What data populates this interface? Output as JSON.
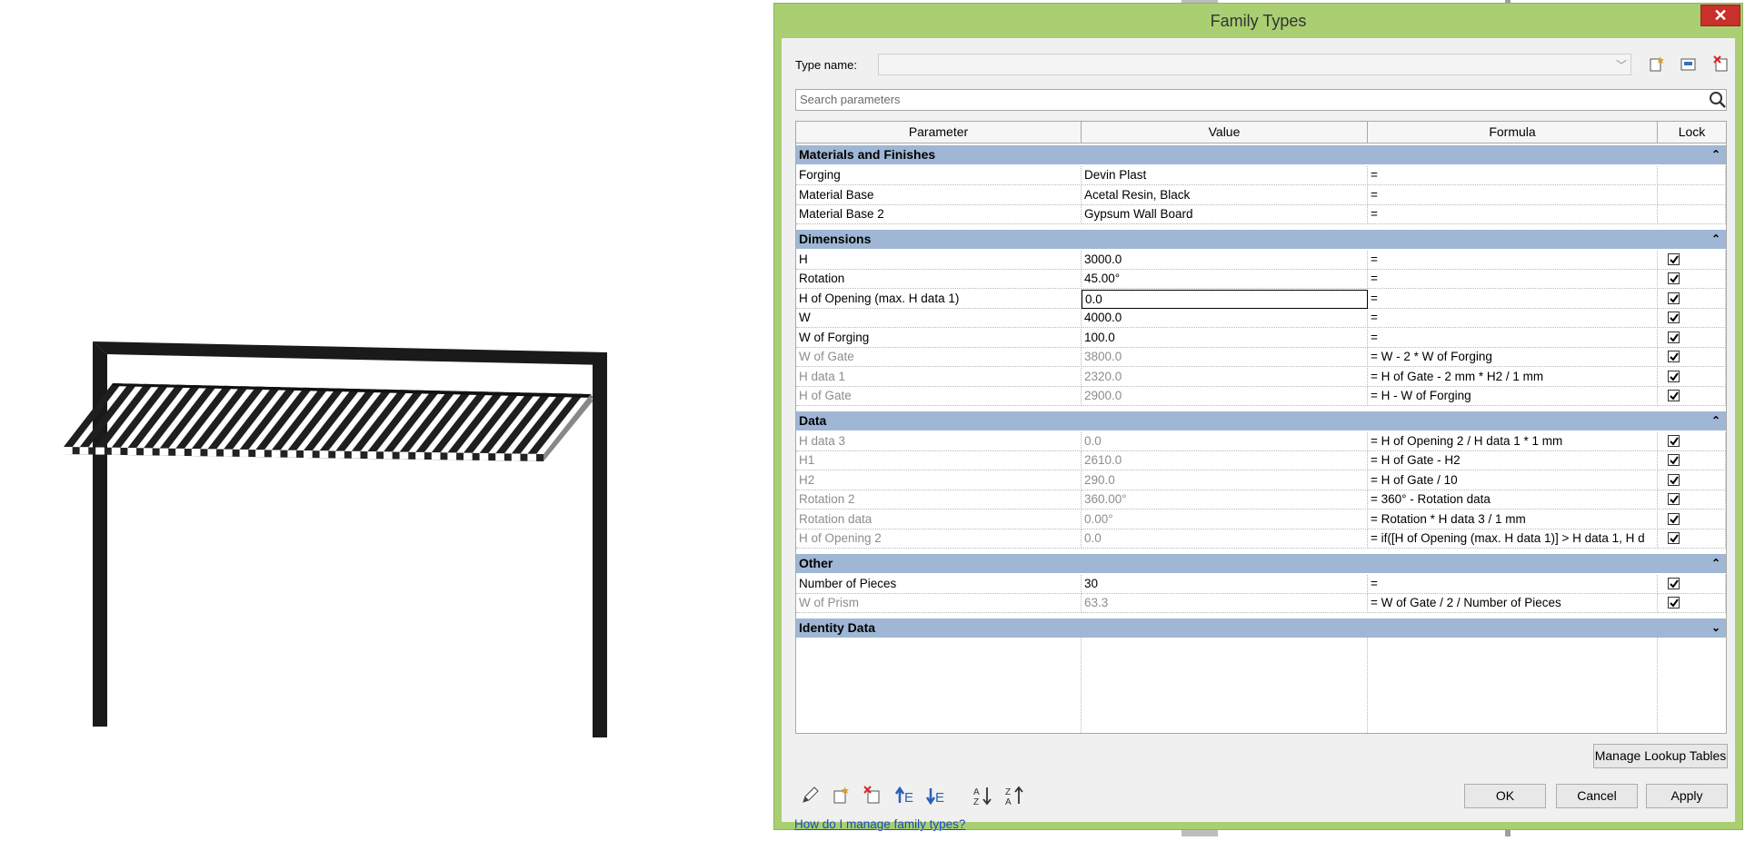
{
  "dialog": {
    "title": "Family Types",
    "close_label": "✕",
    "type_name_label": "Type name:",
    "type_name_value": "",
    "search_placeholder": "Search parameters"
  },
  "columns": [
    "Parameter",
    "Value",
    "Formula",
    "Lock"
  ],
  "groups": [
    {
      "name": "Materials and Finishes",
      "rows": [
        {
          "param": "Forging",
          "value": "Devin Plast",
          "formula": "=",
          "lock": null,
          "grey": false
        },
        {
          "param": "Material Base",
          "value": "Acetal Resin, Black",
          "formula": "=",
          "lock": null,
          "grey": false
        },
        {
          "param": "Material Base 2",
          "value": "Gypsum Wall Board",
          "formula": "=",
          "lock": null,
          "grey": false
        }
      ]
    },
    {
      "name": "Dimensions",
      "rows": [
        {
          "param": "H",
          "value": "3000.0",
          "formula": "=",
          "lock": true,
          "grey": false
        },
        {
          "param": "Rotation",
          "value": "45.00°",
          "formula": "=",
          "lock": true,
          "grey": false
        },
        {
          "param": "H of Opening (max. H data 1)",
          "value": "0.0",
          "formula": "=",
          "lock": true,
          "grey": false,
          "editing": true
        },
        {
          "param": "W",
          "value": "4000.0",
          "formula": "=",
          "lock": true,
          "grey": false
        },
        {
          "param": "W of Forging",
          "value": "100.0",
          "formula": "=",
          "lock": true,
          "grey": false
        },
        {
          "param": "W of Gate",
          "value": "3800.0",
          "formula": "= W - 2 * W of Forging",
          "lock": true,
          "grey": true
        },
        {
          "param": "H data 1",
          "value": "2320.0",
          "formula": "= H of Gate - 2 mm * H2 / 1 mm",
          "lock": true,
          "grey": true
        },
        {
          "param": "H of Gate",
          "value": "2900.0",
          "formula": "= H - W of Forging",
          "lock": true,
          "grey": true
        }
      ]
    },
    {
      "name": "Data",
      "rows": [
        {
          "param": "H data 3",
          "value": "0.0",
          "formula": "= H of Opening 2 / H data 1 * 1 mm",
          "lock": true,
          "grey": true
        },
        {
          "param": "H1",
          "value": "2610.0",
          "formula": "= H of Gate - H2",
          "lock": true,
          "grey": true
        },
        {
          "param": "H2",
          "value": "290.0",
          "formula": "= H of Gate / 10",
          "lock": true,
          "grey": true
        },
        {
          "param": "Rotation 2",
          "value": "360.00°",
          "formula": "= 360° - Rotation data",
          "lock": true,
          "grey": true
        },
        {
          "param": "Rotation data",
          "value": "0.00°",
          "formula": "= Rotation * H data 3 / 1 mm",
          "lock": true,
          "grey": true
        },
        {
          "param": "H of Opening 2",
          "value": "0.0",
          "formula": "= if([H of Opening (max. H data 1)] > H data 1, H d",
          "lock": true,
          "grey": true
        }
      ]
    },
    {
      "name": "Other",
      "rows": [
        {
          "param": "Number of Pieces",
          "value": "30",
          "formula": "=",
          "lock": true,
          "grey": false
        },
        {
          "param": "W of Prism",
          "value": "63.3",
          "formula": "= W of Gate / 2 / Number of Pieces",
          "lock": true,
          "grey": true
        }
      ]
    },
    {
      "name": "Identity Data",
      "rows": []
    }
  ],
  "buttons": {
    "manage_lookup": "Manage Lookup Tables",
    "ok": "OK",
    "cancel": "Cancel",
    "apply": "Apply"
  },
  "help_link": "How do I manage family types?",
  "icons": {
    "toolbar": [
      "new-type-icon",
      "rename-type-icon",
      "delete-type-icon"
    ],
    "bottom": [
      "edit-parameter-icon",
      "new-parameter-icon",
      "delete-parameter-icon",
      "move-up-icon",
      "move-down-icon",
      "sort-ascending-icon",
      "sort-descending-icon"
    ]
  }
}
